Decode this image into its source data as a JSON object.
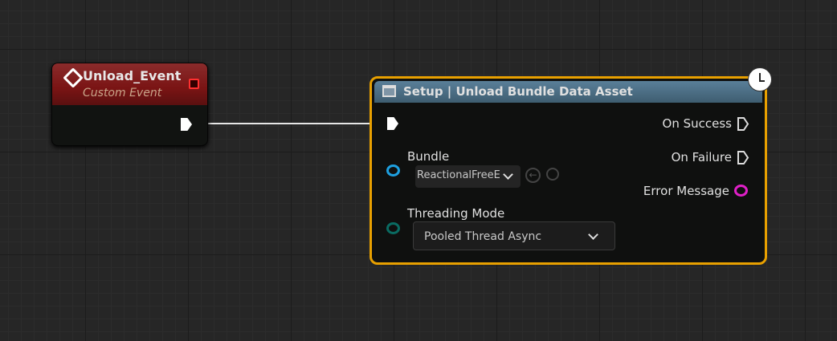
{
  "event_node": {
    "title": "Unload_Event",
    "subtitle": "Custom Event"
  },
  "async_node": {
    "title": "Setup | Unload Bundle Data Asset",
    "inputs": {
      "bundle_label": "Bundle",
      "bundle_value": "ReactionalFreeE",
      "threading_label": "Threading Mode",
      "threading_value": "Pooled Thread Async"
    },
    "outputs": {
      "success": "On Success",
      "failure": "On Failure",
      "error": "Error Message"
    }
  },
  "colors": {
    "event_header": "#7a1414",
    "selection": "#e8a000",
    "object_pin": "#1ea0e0",
    "enum_pin": "#0a6b62",
    "string_pin": "#e020c8"
  }
}
